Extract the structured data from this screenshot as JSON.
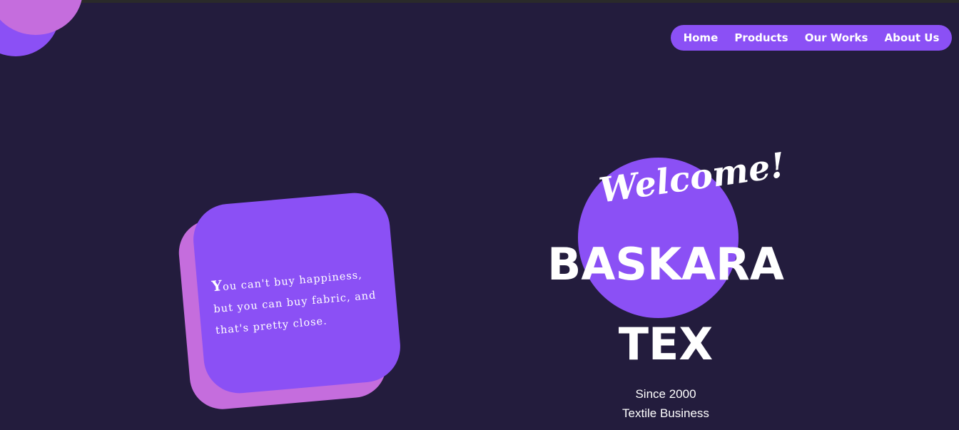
{
  "nav": {
    "items": [
      {
        "label": "Home"
      },
      {
        "label": "Products"
      },
      {
        "label": "Our Works"
      },
      {
        "label": "About Us"
      }
    ]
  },
  "quote": {
    "first_letter": "Y",
    "text": "ou can't buy happiness, but you can buy fabric, and that's pretty close."
  },
  "hero": {
    "welcome": "Welcome!",
    "brand_line_1": "BASKARA",
    "brand_line_2": "TEX",
    "since": "Since 2000",
    "tagline": "Textile Business"
  },
  "colors": {
    "background": "#231c3d",
    "accent_purple": "#8b50f5",
    "accent_pink": "#c56ddd",
    "text": "#ffffff"
  }
}
